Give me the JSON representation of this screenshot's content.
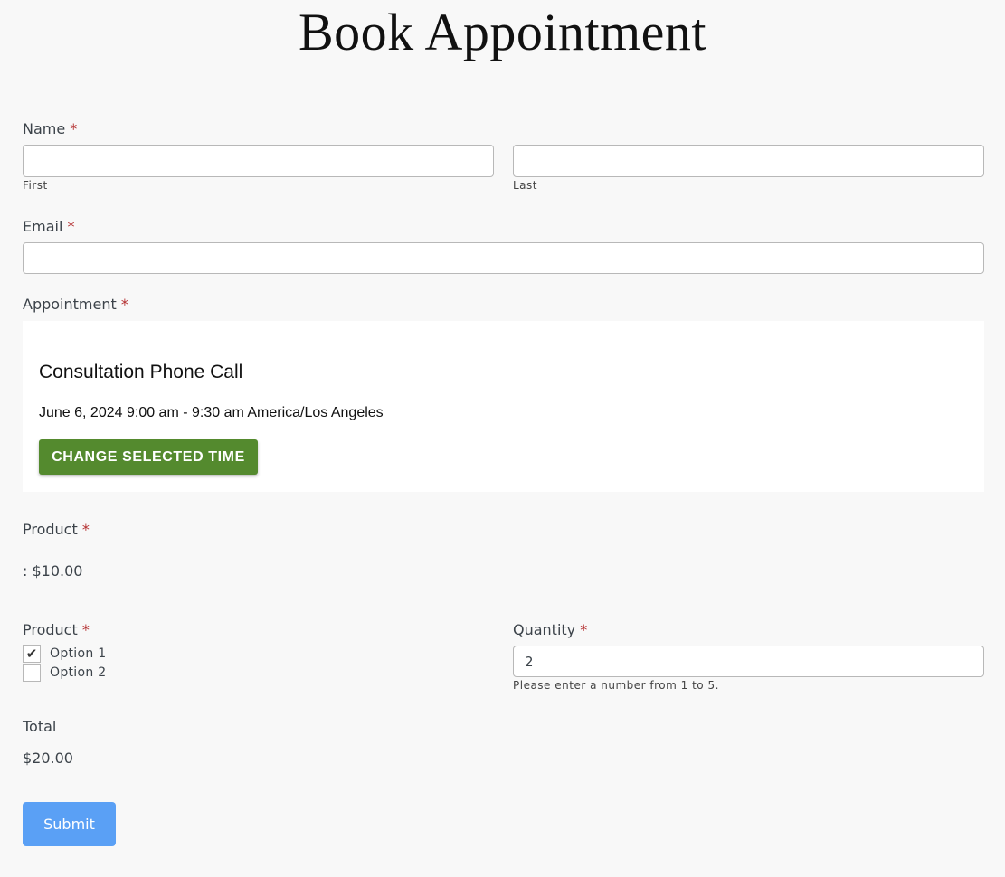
{
  "header": {
    "title": "Book Appointment"
  },
  "name_field": {
    "label": "Name",
    "required_mark": "*",
    "first": {
      "value": "",
      "sublabel": "First"
    },
    "last": {
      "value": "",
      "sublabel": "Last"
    }
  },
  "email_field": {
    "label": "Email",
    "required_mark": "*",
    "value": ""
  },
  "appointment": {
    "label": "Appointment",
    "required_mark": "*",
    "service": "Consultation Phone Call",
    "datetime": "June 6, 2024 9:00 am - 9:30 am America/Los Angeles",
    "change_button": "CHANGE SELECTED TIME",
    "button_color": "#548a2e"
  },
  "product_single": {
    "label": "Product",
    "required_mark": "*",
    "price_text": ": $10.00"
  },
  "product_options": {
    "label": "Product",
    "required_mark": "*",
    "options": [
      {
        "label": "Option 1",
        "checked": true,
        "check_glyph": "✔"
      },
      {
        "label": "Option 2",
        "checked": false,
        "check_glyph": ""
      }
    ]
  },
  "quantity": {
    "label": "Quantity",
    "required_mark": "*",
    "value": "2",
    "hint": "Please enter a number from 1 to 5."
  },
  "total": {
    "label": "Total",
    "value": "$20.00"
  },
  "submit": {
    "label": "Submit",
    "color": "#5aa0f5"
  }
}
